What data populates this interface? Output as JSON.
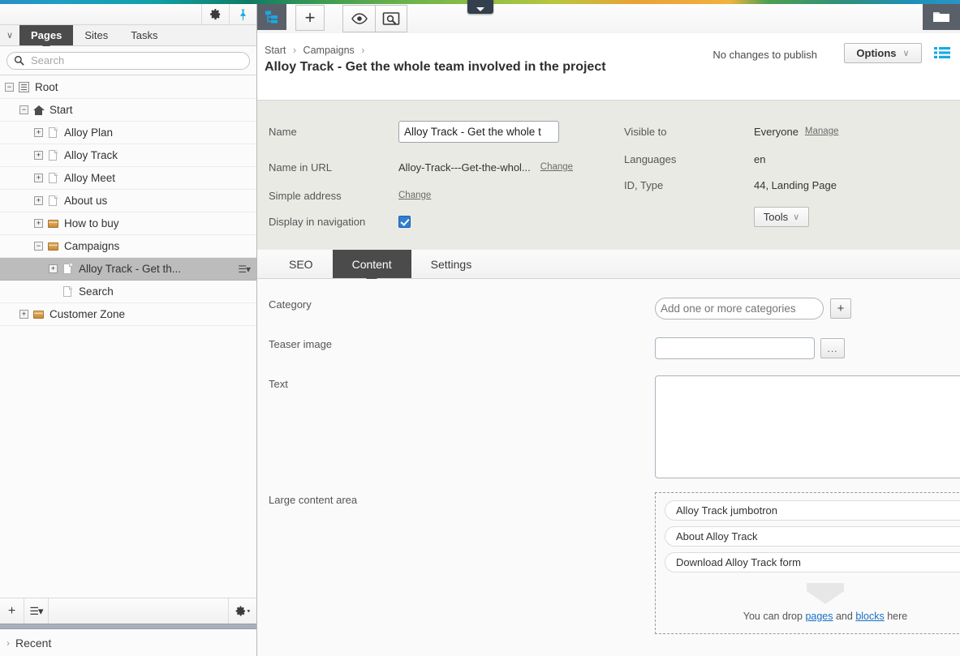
{
  "window": {
    "gradient_colors": [
      "#2a8fc4",
      "#11a0a8",
      "#3f9e52",
      "#8fbf45",
      "#e8a23a",
      "#4d9e52",
      "#1f8fb8"
    ]
  },
  "nav": {
    "topbar": {
      "settings_icon": "gear-icon",
      "pin_icon": "pin-icon"
    },
    "collapse_icon": "chevron-down-icon",
    "tabs": [
      {
        "label": "Pages",
        "active": true
      },
      {
        "label": "Sites",
        "active": false
      },
      {
        "label": "Tasks",
        "active": false
      }
    ],
    "search": {
      "placeholder": "Search",
      "value": "",
      "icon": "search-icon"
    },
    "tree": [
      {
        "label": "Root",
        "indent": 0,
        "expander": "−",
        "icon": "root-icon",
        "selected": false
      },
      {
        "label": "Start",
        "indent": 1,
        "expander": "−",
        "icon": "home-icon",
        "selected": false
      },
      {
        "label": "Alloy Plan",
        "indent": 2,
        "expander": "+",
        "icon": "page-icon",
        "selected": false
      },
      {
        "label": "Alloy Track",
        "indent": 2,
        "expander": "+",
        "icon": "page-icon",
        "selected": false
      },
      {
        "label": "Alloy Meet",
        "indent": 2,
        "expander": "+",
        "icon": "page-icon",
        "selected": false
      },
      {
        "label": "About us",
        "indent": 2,
        "expander": "+",
        "icon": "page-icon",
        "selected": false
      },
      {
        "label": "How to buy",
        "indent": 2,
        "expander": "+",
        "icon": "folder-icon",
        "selected": false
      },
      {
        "label": "Campaigns",
        "indent": 2,
        "expander": "−",
        "icon": "folder-icon",
        "selected": false
      },
      {
        "label": "Alloy Track - Get th...",
        "indent": 3,
        "expander": "+",
        "icon": "page-icon",
        "selected": true
      },
      {
        "label": "Search",
        "indent": 3,
        "expander": "",
        "icon": "page-icon",
        "selected": false
      },
      {
        "label": "Customer Zone",
        "indent": 1,
        "expander": "+",
        "icon": "folder-icon",
        "selected": false
      }
    ],
    "bottom_toolbar": {
      "add_label": "+",
      "menu_icon": "list-menu-icon",
      "settings_icon": "gear-dropdown-icon"
    },
    "recent": {
      "label": "Recent",
      "chevron": "›"
    }
  },
  "toolbar": {
    "structure_icon": "page-tree-icon",
    "add_label": "+",
    "preview_icon": "eye-icon",
    "compare_icon": "compare-view-icon",
    "folder_icon": "assets-folder-icon"
  },
  "header": {
    "breadcrumb": [
      "Start",
      "Campaigns"
    ],
    "breadcrumb_sep": "›",
    "title": "Alloy Track - Get the whole team involved in the project",
    "publish_status": "No changes to publish",
    "options_label": "Options",
    "options_chevron": "∨",
    "list_view_icon": "list-view-icon"
  },
  "details": {
    "left": [
      {
        "label": "Name",
        "type": "input",
        "value": "Alloy Track - Get the whole t"
      },
      {
        "label": "Name in URL",
        "type": "text-link",
        "value": "Alloy-Track---Get-the-whol...",
        "link": "Change"
      },
      {
        "label": "Simple address",
        "type": "link",
        "value": "",
        "link": "Change"
      },
      {
        "label": "Display in navigation",
        "type": "checkbox",
        "checked": true
      }
    ],
    "right": [
      {
        "label": "Visible to",
        "value": "Everyone",
        "link": "Manage"
      },
      {
        "label": "Languages",
        "value": "en",
        "link": ""
      },
      {
        "label": "ID, Type",
        "value": "44, Landing Page",
        "link": ""
      }
    ],
    "tools_label": "Tools",
    "tools_chevron": "∨"
  },
  "tabs": [
    {
      "label": "SEO",
      "active": false
    },
    {
      "label": "Content",
      "active": true
    },
    {
      "label": "Settings",
      "active": false
    }
  ],
  "form": {
    "category": {
      "label": "Category",
      "placeholder": "Add one or more categories",
      "value": "",
      "add_label": "+"
    },
    "teaser_image": {
      "label": "Teaser image",
      "value": "",
      "browse_label": "..."
    },
    "text": {
      "label": "Text",
      "value": ""
    },
    "large_content_area": {
      "label": "Large content area",
      "items": [
        "Alloy Track jumbotron",
        "About Alloy Track",
        "Download Alloy Track form"
      ],
      "drop_hint_prefix": "You can drop ",
      "drop_hint_link1": "pages",
      "drop_hint_mid": " and ",
      "drop_hint_link2": "blocks",
      "drop_hint_suffix": " here",
      "drop_arrow_icon": "down-arrow-icon"
    }
  }
}
